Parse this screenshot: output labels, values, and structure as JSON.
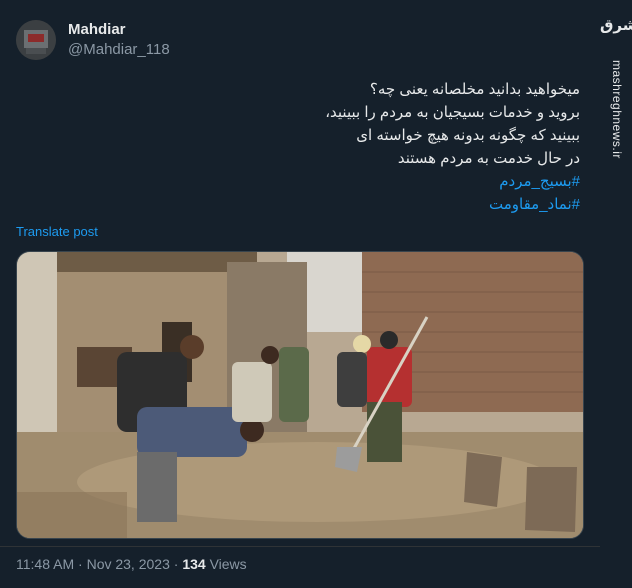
{
  "author": {
    "display_name": "Mahdiar",
    "handle": "@Mahdiar_118"
  },
  "post": {
    "lines": [
      "میخواهید بدانید مخلصانه یعنی چه؟",
      "بروید و خدمات بسیجیان به مردم را ببینید،",
      "ببینید که چگونه بدونه هیچ خواسته ای",
      "در حال خدمت به مردم هستند"
    ],
    "hashtags": [
      "#بسیج_مردم",
      "#نماد_مقاومت"
    ],
    "translate_label": "Translate post"
  },
  "meta": {
    "time": "11:48 AM",
    "separator1": " · ",
    "date": "Nov 23, 2023",
    "separator2": " · ",
    "views_count": "134",
    "views_label": " Views"
  },
  "watermark": {
    "logo": "مشرق",
    "site": "mashreghnews.ir"
  },
  "colors": {
    "background": "#15202b",
    "accent": "#1d9bf0",
    "secondary_text": "#8b98a5"
  }
}
